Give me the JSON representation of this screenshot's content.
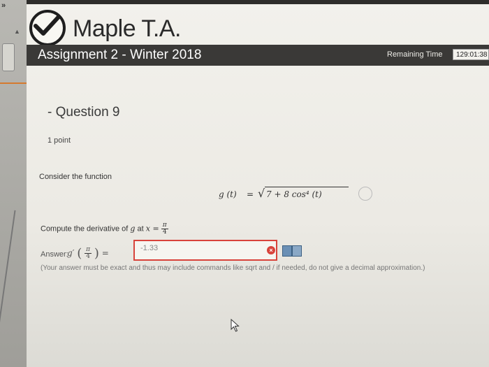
{
  "sidebar": {
    "chevron": "»",
    "collapse_caret": "▲"
  },
  "app": {
    "name": "Maple T.A.",
    "logo_icon": "checkmark-circle-icon"
  },
  "assignment": {
    "title": "Assignment 2 - Winter 2018",
    "remaining_label": "Remaining Time",
    "remaining_value": "129:01:38"
  },
  "question": {
    "title": "- Question 9",
    "points": "1 point",
    "prompt": "Consider the function",
    "formula": {
      "lhs": "g (t)",
      "eq": "=",
      "radicand": "7 + 8 cos⁴ (t)"
    },
    "compute_text": "Compute the derivative of",
    "compute_var": "g",
    "compute_at": "at",
    "compute_x": "x =",
    "frac_num": "π",
    "frac_den": "4",
    "answer_label": "Answer:",
    "answer_func": "g′",
    "answer_eq": "=",
    "answer_value": "-1.33",
    "note": "(Your answer must be exact and thus may include commands like sqrt and / if needed, do not give a decimal approximation.)"
  },
  "colors": {
    "banner": "#3a3937",
    "error": "#d8433b",
    "accent": "#d57a2e"
  }
}
